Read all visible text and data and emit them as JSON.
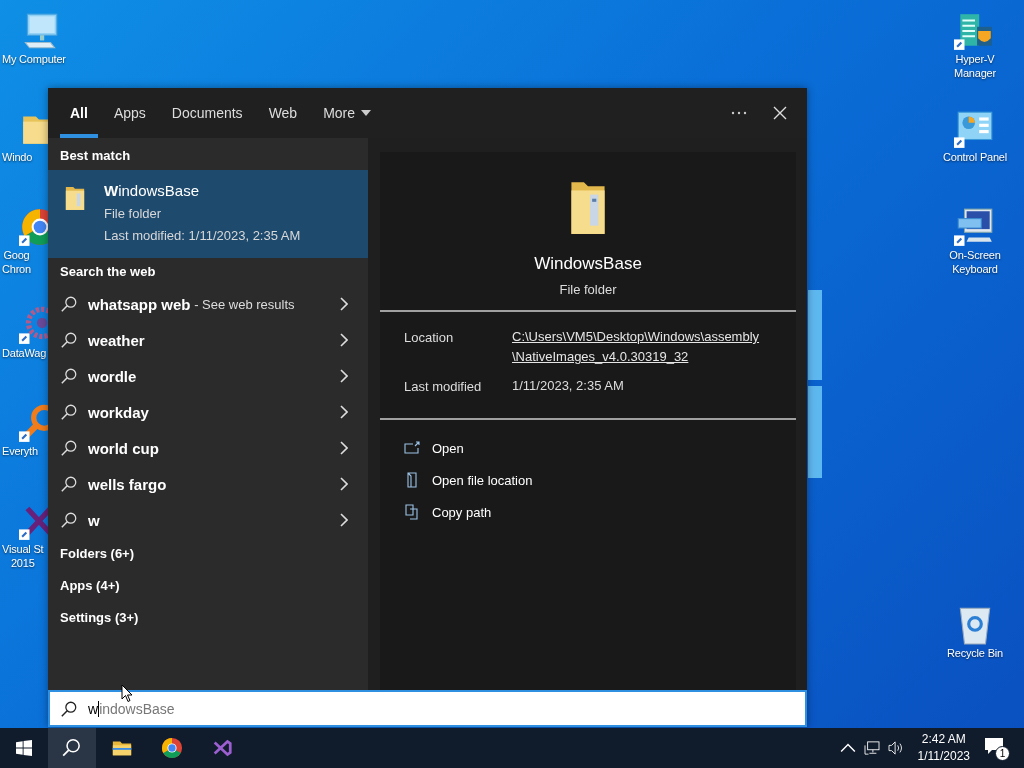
{
  "desktop_icons_left": [
    {
      "label": "My Computer",
      "kind": "computer"
    },
    {
      "label": "Windo",
      "kind": "folder"
    },
    {
      "label": "Goog\nChron",
      "kind": "chrome"
    },
    {
      "label": "DataWag",
      "kind": "gear"
    },
    {
      "label": "Everyth",
      "kind": "magnifier"
    },
    {
      "label": "Visual St\n2015",
      "kind": "vs"
    }
  ],
  "desktop_icons_right": [
    {
      "label": "Hyper-V\nManager",
      "kind": "server"
    },
    {
      "label": "Control Panel",
      "kind": "panel"
    },
    {
      "label": "On-Screen\nKeyboard",
      "kind": "keyboard"
    },
    {
      "label": "Recycle Bin",
      "kind": "bin"
    }
  ],
  "search_panel": {
    "tabs": [
      {
        "label": "All",
        "selected": true,
        "dropdown": false
      },
      {
        "label": "Apps",
        "selected": false,
        "dropdown": false
      },
      {
        "label": "Documents",
        "selected": false,
        "dropdown": false
      },
      {
        "label": "Web",
        "selected": false,
        "dropdown": false
      },
      {
        "label": "More",
        "selected": false,
        "dropdown": true
      }
    ],
    "best_match": {
      "heading": "Best match",
      "name": "**W**indowsBase",
      "type": "File folder",
      "modified": "Last modified: 1/11/2023, 2:35 AM",
      "selected": true
    },
    "web": {
      "heading": "Search the web",
      "items": [
        {
          "query": "whatsapp web",
          "note": " - See web results"
        },
        {
          "query": "weather"
        },
        {
          "query": "wordle"
        },
        {
          "query": "workday"
        },
        {
          "query": "world cup"
        },
        {
          "query": "wells fargo"
        },
        {
          "query": "w"
        }
      ]
    },
    "categories": [
      "Folders (6+)",
      "Apps (4+)",
      "Settings (3+)"
    ],
    "preview": {
      "name": "WindowsBase",
      "type": "File folder",
      "details": [
        {
          "label": "Location",
          "value": "C:\\Users\\VM5\\Desktop\\Windows\\assembly\n\\NativeImages_v4.0.30319_32",
          "link": true
        },
        {
          "label": "Last modified",
          "value": "1/11/2023, 2:35 AM",
          "link": false
        }
      ],
      "actions": [
        {
          "label": "Open",
          "kind": "open"
        },
        {
          "label": "Open file location",
          "kind": "location"
        },
        {
          "label": "Copy path",
          "kind": "copy"
        }
      ]
    },
    "search": {
      "typed": "w",
      "completion": "indowsBase"
    }
  },
  "taskbar": {
    "apps": [
      {
        "kind": "search",
        "selected": true
      },
      {
        "kind": "explorer",
        "selected": false
      },
      {
        "kind": "chrome",
        "selected": false
      },
      {
        "kind": "vs",
        "selected": false
      }
    ],
    "time": "2:42 AM",
    "date": "1/11/2023",
    "notifications": "1"
  }
}
